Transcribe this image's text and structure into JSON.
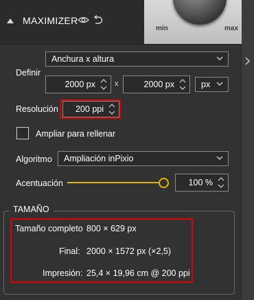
{
  "header": {
    "title": "MAXIMIZER",
    "knob_min": "min",
    "knob_max": "max"
  },
  "definir": {
    "label": "Definir",
    "mode": "Anchura x altura",
    "width": "2000 px",
    "height": "2000 px",
    "times": "x",
    "unit": "px"
  },
  "resolucion": {
    "label": "Resolución",
    "value": "200 ppi"
  },
  "ampliar": {
    "label": "Ampliar para rellenar",
    "checked": false
  },
  "algoritmo": {
    "label": "Algoritmo",
    "value": "Ampliación inPixio"
  },
  "acentuacion": {
    "label": "Acentuación",
    "value": "100 %",
    "level_percent": 100
  },
  "tamano": {
    "title": "TAMAÑO",
    "completo_label": "Tamaño completo",
    "completo_value": "800 × 629 px",
    "final_label": "Final:",
    "final_value": "2000 × 1572 px (×2,5)",
    "impresion_label": "Impresión:",
    "impresion_value": "25,4 × 19,96 cm @ 200 ppi"
  },
  "colors": {
    "accent": "#e6b400",
    "highlight": "#e00000"
  }
}
